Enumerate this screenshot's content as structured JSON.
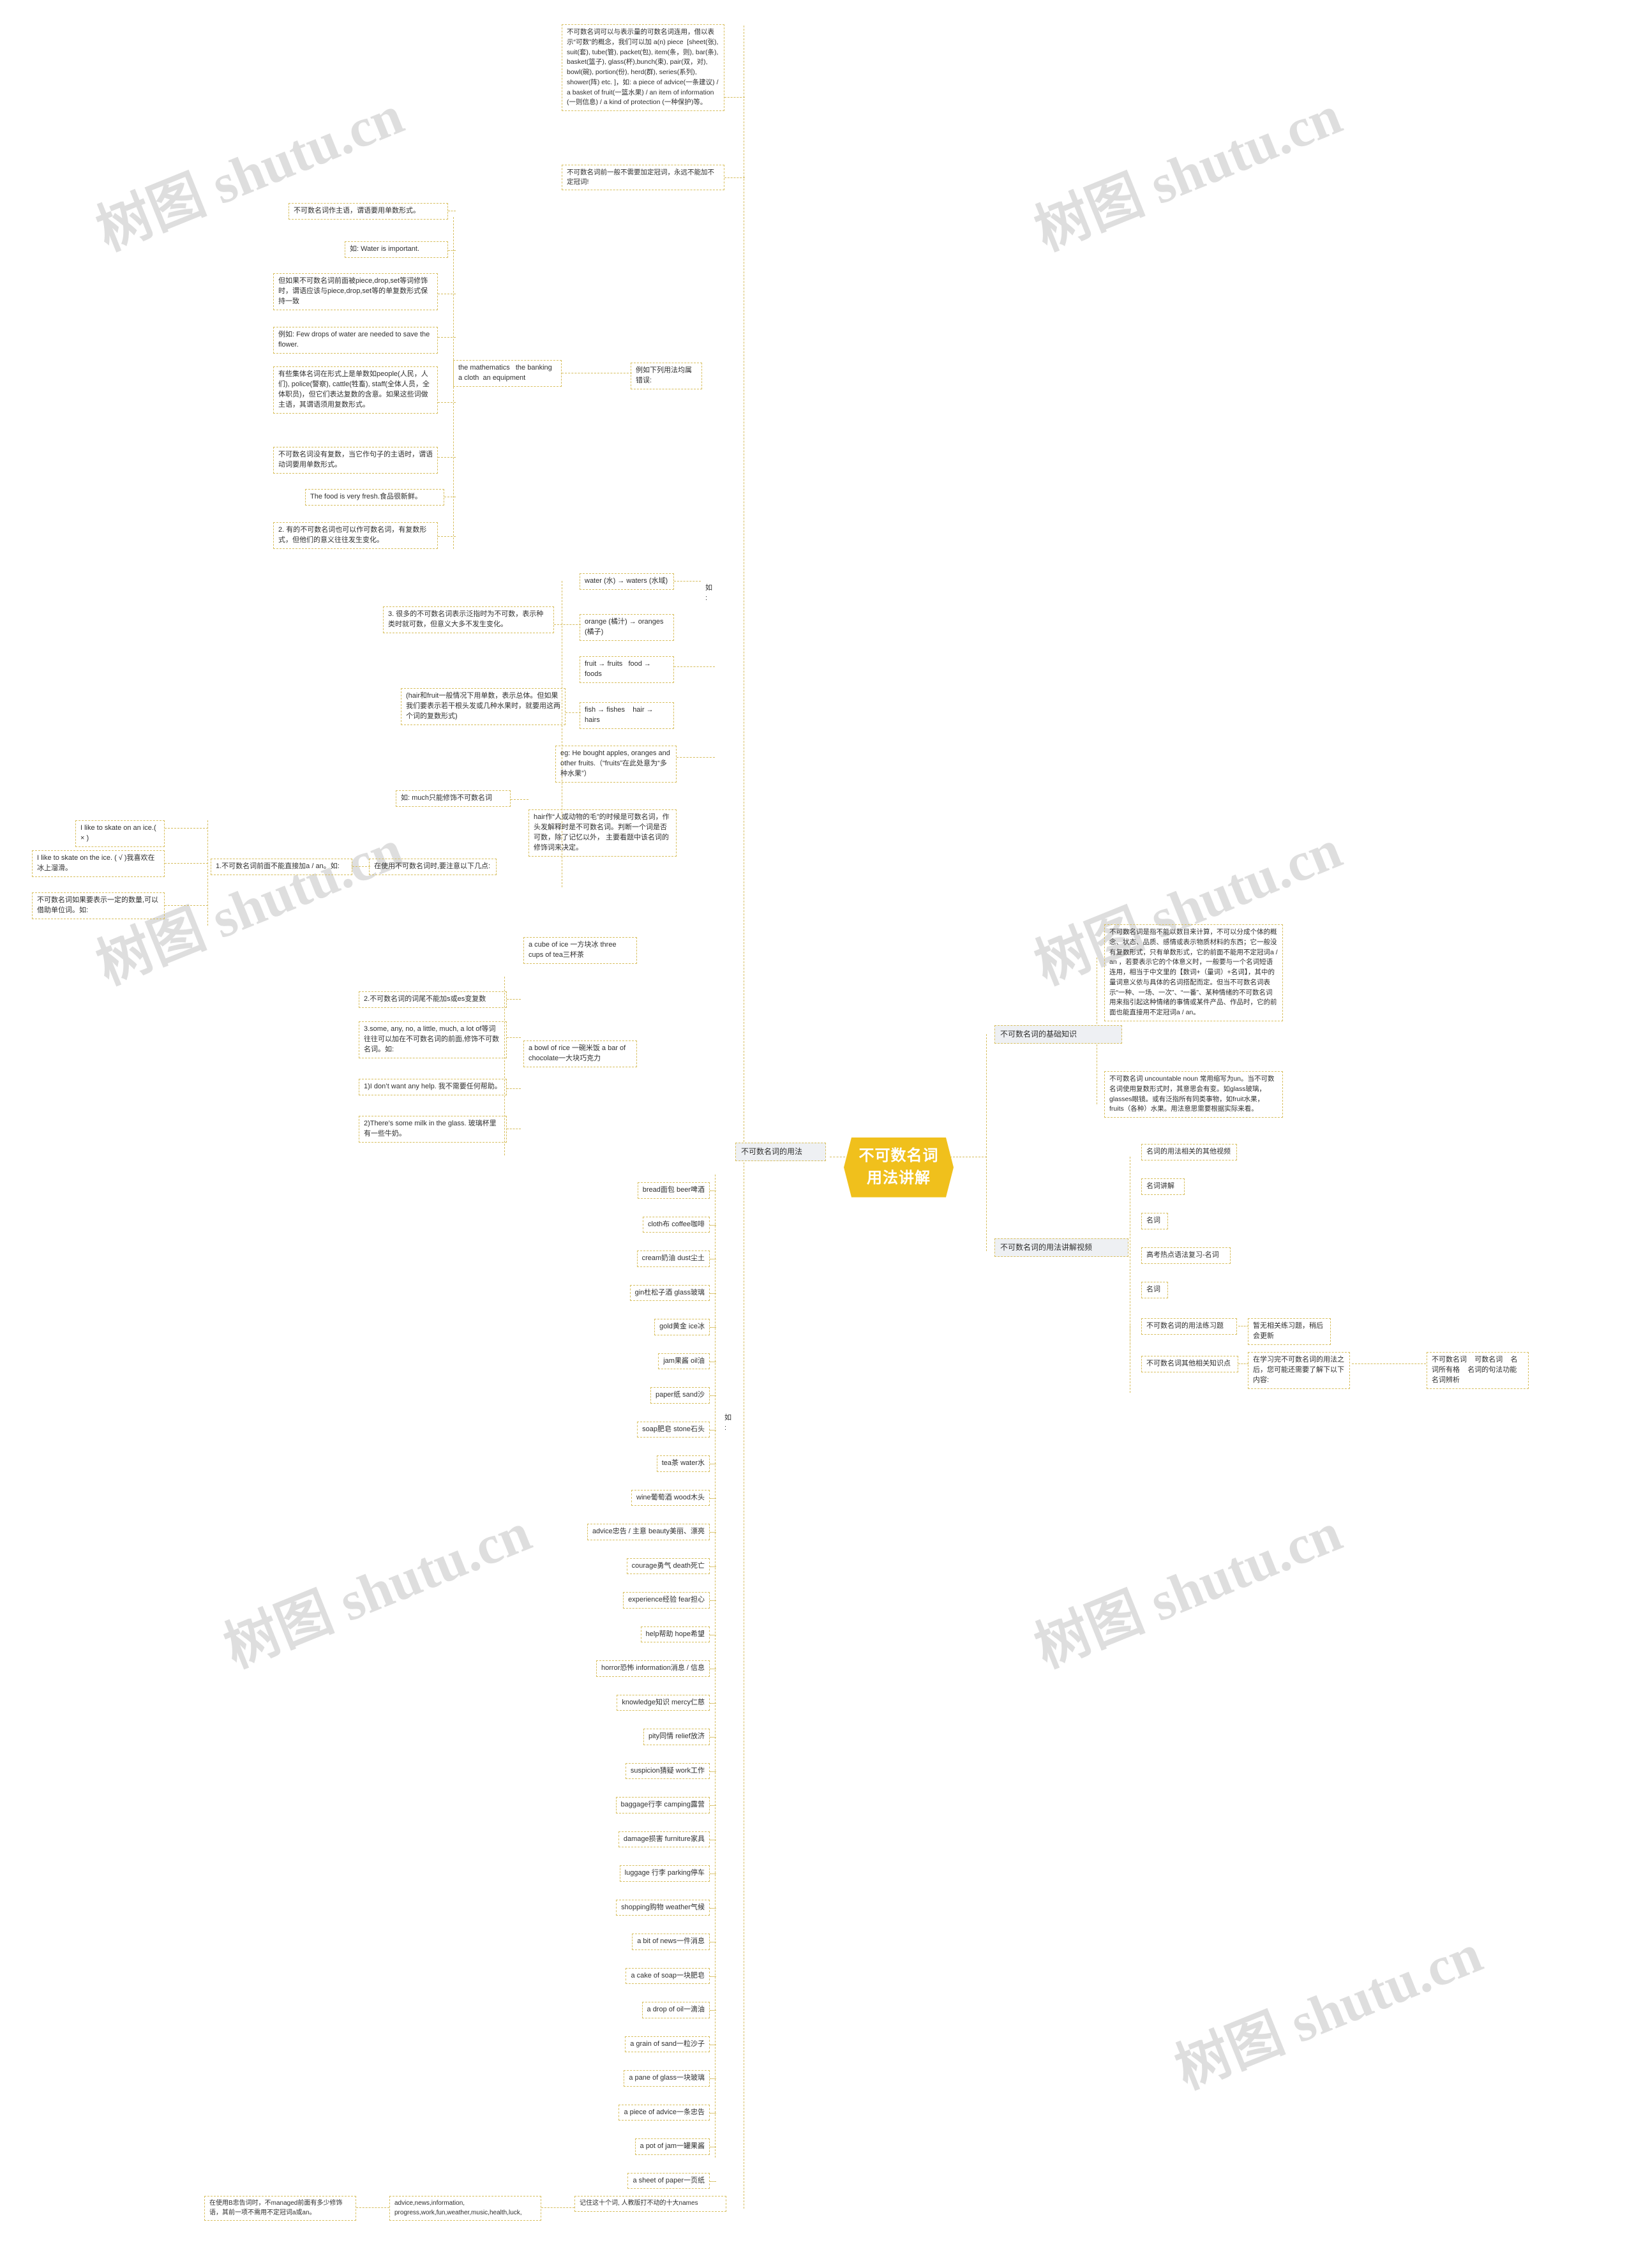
{
  "meta": {
    "watermark_text": "树图 shutu.cn"
  },
  "root": {
    "label": "不可数名词用法讲解"
  },
  "left_branch": {
    "label": "不可数名词的用法"
  },
  "right_branches": [
    {
      "label": "不可数名词的基础知识"
    },
    {
      "label": "不可数名词的用法讲解视频"
    }
  ],
  "basics": [
    {
      "text": "不可数名词是指不能以数目来计算，不可以分成个体的概念、状态、品质、感情或表示物质材料的东西；它一般没有复数形式，只有单数形式，它的前面不能用不定冠词a / an ，若要表示它的个体意义时，一般要与一个名词短语连用，相当于中文里的【数词+（量词）+名词】，其中的量词意义依与具体的名词搭配而定。但当不可数名词表示“一种、一场、一次”、“一番”、某种情绪的不可数名词用来指引起这种情绪的事情或某件产品、作品时，它的前面也能直接用不定冠词a / an。"
    },
    {
      "text": "不可数名词 uncountable noun 常用缩写为un。当不可数名词使用复数形式时，其意思会有变。如glass玻璃，glasses眼镜。或有泛指所有同类事物，如fruit水果，fruits（各种）水果。用法意思需要根据实际来看。"
    }
  ],
  "videos": [
    {
      "label": "名词的用法相关的其他视频"
    },
    {
      "label": "名词讲解"
    },
    {
      "label": "名词"
    },
    {
      "label": "高考热点语法复习-名词"
    },
    {
      "label": "名词"
    }
  ],
  "exercises": {
    "label": "不可数名词的用法练习题",
    "note": "暂无相关练习题，稍后会更新"
  },
  "related": {
    "label": "不可数名词其他相关知识点",
    "intro": "在学习完不可数名词的用法之后，您可能还需要了解下以下内容:",
    "items": "不可数名词    可数名词    名词所有格    名词的句法功能    名词辨析"
  },
  "left_nodes": {
    "n_quantifier": "不可数名词可以与表示量的可数名词连用，借以表示“可数”的概念，我们可以加 a(n) piece  [sheet(张), suit(套), tube(管), packet(包), item(条，则), bar(条), basket(篮子), glass(杯),bunch(束), pair(双，对), bowl(碗), portion(份), herd(群), series(系列), shower(阵) etc. ]，如: a piece of advice(一条建议) / a basket of fruit(一篮水果) / an item of information (一则信息) / a kind of protection (一种保护)等。",
    "n_article": "不可数名词前一般不需要加定冠词，永远不能加不定冠词!",
    "n_subject_singular": "不可数名词作主语，谓语要用单数形式。",
    "n_example_water": "如: Water is important.",
    "n_piece_drop_set": "但如果不可数名词前面被piece,drop,set等词修饰时，谓语应该与piece,drop,set等的单复数形式保持一致",
    "n_few_drops": "例如: Few drops of water are needed to save the flower.",
    "n_collective": "有些集体名词在形式上是单数如people(人民，人们), police(警察), cattle(牲畜), staff(全体人员，全体职员)，但它们表达复数的含意。如果这些词做主语，其谓语须用复数形式。",
    "n_no_plural": "不可数名词没有复数，当它作句子的主语时，谓语动词要用单数形式。",
    "n_food_fresh": "The food is very fresh.食品很新鲜。",
    "n_rule2": "2. 有的不可数名词也可以作可数名词，有复数形式，但他们的意义往往发生变化。",
    "n_math_wrong": "the mathematics   the banking  a cloth  an equipment",
    "n_wrong_usage": "例如下列用法均属错误:",
    "n_rule3": "3. 很多的不可数名词表示泛指时为不可数，表示种类时就可数，但意义大多不发生变化。",
    "n_water_waters": "water (水) → waters (水域)",
    "n_orange_oranges": "orange (橘汁) → oranges (橘子)",
    "n_ru": "如:",
    "n_fruit_food": "fruit → fruits   food → foods",
    "n_fish_hair": "fish → fishes    hair → hairs",
    "n_hair_fruit_note": "(hair和fruit一般情况下用单数，表示总体。但如果我们要表示若干根头发或几种水果时，就要用这两个词的复数形式)",
    "n_eg_bought": "eg: He bought apples, oranges and other fruits.（“fruits”在此处意为“多种水果”）",
    "n_much": "如: much只能修饰不可数名词",
    "n_hair_note": "hair作“人或动物的毛”的时候是可数名词，作头发解释时是不可数名词。判断一个词是否可数，除了记忆以外， 主要看题中该名词的修饰词来决定。",
    "n_skate_wrong": "I like to skate on an ice.( × )",
    "n_skate_right": "I like to skate on the ice. ( √ )我喜欢在冰上溜滑。",
    "n_unit_words": "不可数名词如果要表示一定的数量,可以借助单位词。如:",
    "n_rule_a_an": "1.不可数名词前面不能直接加a / an。如:",
    "n_attention": "在使用不可数名词时,要注意以下几点:",
    "n_rule_no_s": "2.不可数名词的词尾不能加s或es变复数",
    "n_rule_some_any": "3.some, any, no, a little, much, a lot of等词往往可以加在不可数名词的前面,修饰不可数名词。如:",
    "n_eg1": "1)I don’t want any help. 我不需要任何帮助。",
    "n_eg2": "2)There’s some milk in the glass. 玻璃杯里有一些牛奶。",
    "n_cube_ice": "a cube of ice 一方块冰 three cups of tea三杯茶",
    "n_bowl_rice": "a bowl of rice 一碗米饭 a bar of chocolate一大块巧克力"
  },
  "word_list_label": "如:",
  "word_list": [
    "bread面包 beer啤酒",
    "cloth布 coffee咖啡",
    "cream奶油 dust尘土",
    "gin杜松子酒 glass玻璃",
    "gold黄金 ice冰",
    "jam果酱 oil油",
    "paper纸 sand沙",
    "soap肥皂 stone石头",
    "tea茶 water水",
    "wine葡萄酒 wood木头",
    "advice忠告 / 主意 beauty美丽、漂亮",
    "courage勇气 death死亡",
    "experience经验 fear担心",
    "help帮助 hope希望",
    "horror恐怖 information消息 / 信息",
    "knowledge知识 mercy仁慈",
    "pity同情 relief放济",
    "suspicion猜疑 work工作",
    "baggage行李 camping露营",
    "damage损害 furniture家具",
    "luggage 行李 parking停车",
    "shopping购物 weather气候",
    "a bit of news一件消息",
    "a cake of soap一块肥皂",
    "a drop of oil一滴油",
    "a grain of sand一粒沙子",
    "a pane of glass一块玻璃",
    "a piece of advice一条忠告",
    "a pot of jam一罐果酱",
    "a sheet of paper一页纸"
  ],
  "bottom": {
    "left_note": "在使用B忠告词时，不managed前面有多少修饰语，其前一项不需用不定冠词a或an。",
    "mid_note": "advice,news,information, progress,work,fun,weather,music,health,luck,",
    "right_note": "记住这十个词, 人教版打不动的十大names"
  }
}
